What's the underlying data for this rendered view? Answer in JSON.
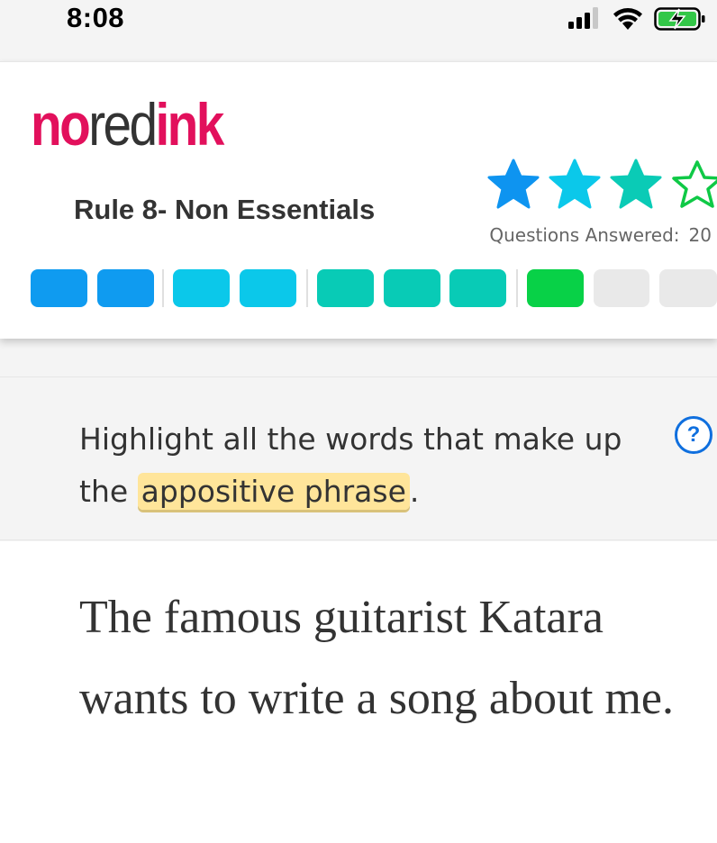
{
  "status_bar": {
    "time": "8:08"
  },
  "header": {
    "logo": {
      "part1": "no",
      "part2": "red",
      "part3": "ink"
    },
    "rule_title": "Rule 8- Non Essentials",
    "stars": [
      {
        "icon": "star-icon",
        "filled": true,
        "color": "#0e94f0"
      },
      {
        "icon": "star-icon",
        "filled": true,
        "color": "#0bc8ea"
      },
      {
        "icon": "star-icon",
        "filled": true,
        "color": "#0acbb6"
      },
      {
        "icon": "star-outline-icon",
        "filled": false,
        "color": "#0fc946"
      }
    ],
    "questions_answered_label": "Questions Answered:",
    "questions_answered_count": "20"
  },
  "progress": {
    "segments": [
      "#0f9bf0",
      "#0f9bf0",
      "#0bc8ea",
      "#0bc8ea",
      "#08cbb6",
      "#08cbb6",
      "#08cbb6",
      "#08d147",
      "#e9e9e9",
      "#e9e9e9"
    ]
  },
  "prompt": {
    "text_before": "Highlight all the words that make up the ",
    "highlight": "appositive phrase",
    "text_after": ".",
    "help_label": "?"
  },
  "sentence": {
    "text": "The famous guitarist Katara wants to write a song about me."
  },
  "colors": {
    "brand": "#e2105c",
    "highlight": "#ffe59a",
    "help": "#0f6fde"
  }
}
